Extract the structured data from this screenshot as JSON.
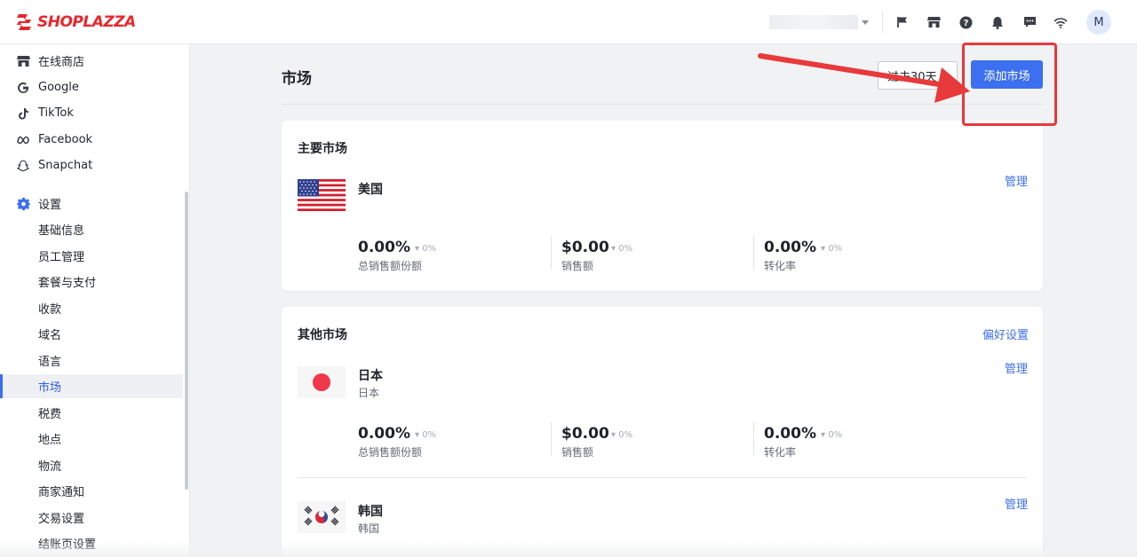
{
  "brand": {
    "logo_text": "SHOPLAZZA",
    "accent": "#e8262d"
  },
  "topbar": {
    "icons": [
      "flag-icon",
      "store-icon",
      "help-icon",
      "bell-icon",
      "chat-icon",
      "wifi-icon"
    ],
    "avatar_letter": "M"
  },
  "sidebar": {
    "channels": [
      {
        "label": "在线商店",
        "icon": "store-icon"
      },
      {
        "label": "Google",
        "icon": "google-icon"
      },
      {
        "label": "TikTok",
        "icon": "tiktok-icon"
      },
      {
        "label": "Facebook",
        "icon": "meta-icon"
      },
      {
        "label": "Snapchat",
        "icon": "snapchat-icon"
      }
    ],
    "settings_label": "设置",
    "settings_items": [
      "基础信息",
      "员工管理",
      "套餐与支付",
      "收款",
      "域名",
      "语言",
      "市场",
      "税费",
      "地点",
      "物流",
      "商家通知",
      "交易设置",
      "结账页设置"
    ],
    "active_item": "市场"
  },
  "main": {
    "title": "市场",
    "date_range": "过去30天",
    "add_button": "添加市场",
    "primary": {
      "title": "主要市场",
      "market": {
        "name": "美国",
        "manage": "管理",
        "metrics": [
          {
            "value": "0.00%",
            "change": "0%",
            "label": "总销售额份额"
          },
          {
            "value": "$0.00",
            "change": "0%",
            "label": "销售额"
          },
          {
            "value": "0.00%",
            "change": "0%",
            "label": "转化率"
          }
        ]
      }
    },
    "other": {
      "title": "其他市场",
      "preferences": "偏好设置",
      "markets": [
        {
          "name": "日本",
          "sub": "日本",
          "manage": "管理",
          "metrics": [
            {
              "value": "0.00%",
              "change": "0%",
              "label": "总销售额份额"
            },
            {
              "value": "$0.00",
              "change": "0%",
              "label": "销售额"
            },
            {
              "value": "0.00%",
              "change": "0%",
              "label": "转化率"
            }
          ]
        },
        {
          "name": "韩国",
          "sub": "韩国",
          "manage": "管理"
        }
      ]
    }
  },
  "colors": {
    "primary_blue": "#3d6ff1",
    "annotation_red": "#e8393b"
  }
}
